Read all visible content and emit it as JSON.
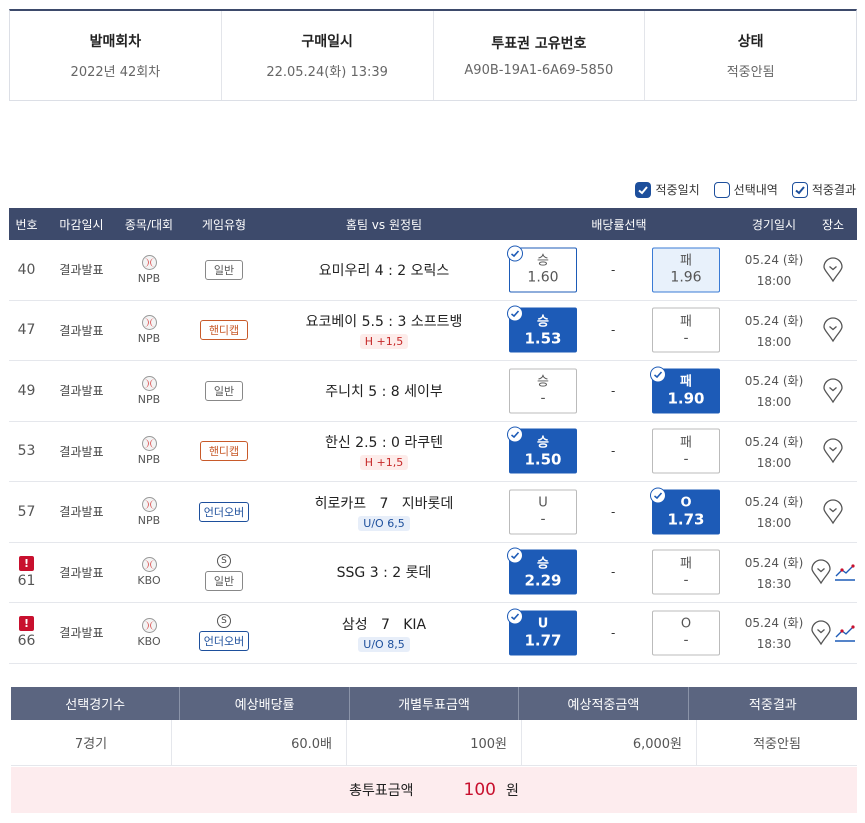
{
  "info": {
    "round_label": "발매회차",
    "round_value": "2022년 42회차",
    "date_label": "구매일시",
    "date_value": "22.05.24(화) 13:39",
    "ticket_label": "투표권 고유번호",
    "ticket_value": "A90B-19A1-6A69-5850",
    "status_label": "상태",
    "status_value": "적중안됨"
  },
  "legend": {
    "hit": "적중일치",
    "selected": "선택내역",
    "result": "적중결과"
  },
  "header": {
    "no": "번호",
    "close": "마감일시",
    "league": "종목/대회",
    "type": "게임유형",
    "match": "홈팀 vs 원정팀",
    "odds": "배당률선택",
    "date": "경기일시",
    "place": "장소"
  },
  "rows": [
    {
      "no": "40",
      "close": "결과발표",
      "league": "NPB",
      "type": "일반",
      "match": "요미우리 4 : 2 오릭스",
      "sub": "",
      "left_label": "승",
      "left_odds": "1.60",
      "mid": "-",
      "right_label": "패",
      "right_odds": "1.96",
      "date": "05.24 (화)",
      "time": "18:00"
    },
    {
      "no": "47",
      "close": "결과발표",
      "league": "NPB",
      "type": "핸디캡",
      "match": "요코베이 5.5 : 3 소프트뱅",
      "sub": "H +1,5",
      "left_label": "승",
      "left_odds": "1.53",
      "mid": "-",
      "right_label": "패",
      "right_odds": "-",
      "date": "05.24 (화)",
      "time": "18:00"
    },
    {
      "no": "49",
      "close": "결과발표",
      "league": "NPB",
      "type": "일반",
      "match": "주니치 5 : 8 세이부",
      "sub": "",
      "left_label": "승",
      "left_odds": "-",
      "mid": "-",
      "right_label": "패",
      "right_odds": "1.90",
      "date": "05.24 (화)",
      "time": "18:00"
    },
    {
      "no": "53",
      "close": "결과발표",
      "league": "NPB",
      "type": "핸디캡",
      "match": "한신 2.5 : 0 라쿠텐",
      "sub": "H +1,5",
      "left_label": "승",
      "left_odds": "1.50",
      "mid": "-",
      "right_label": "패",
      "right_odds": "-",
      "date": "05.24 (화)",
      "time": "18:00"
    },
    {
      "no": "57",
      "close": "결과발표",
      "league": "NPB",
      "type": "언더오버",
      "match": "히로카프   7   지바롯데",
      "sub": "U/O 6,5",
      "left_label": "U",
      "left_odds": "-",
      "mid": "-",
      "right_label": "O",
      "right_odds": "1.73",
      "date": "05.24 (화)",
      "time": "18:00"
    },
    {
      "no": "61",
      "close": "결과발표",
      "league": "KBO",
      "type": "일반",
      "match": "SSG 3 : 2 롯데",
      "sub": "",
      "left_label": "승",
      "left_odds": "2.29",
      "mid": "-",
      "right_label": "패",
      "right_odds": "-",
      "date": "05.24 (화)",
      "time": "18:30"
    },
    {
      "no": "66",
      "close": "결과발표",
      "league": "KBO",
      "type": "언더오버",
      "match": "삼성   7   KIA",
      "sub": "U/O 8,5",
      "left_label": "U",
      "left_odds": "1.77",
      "mid": "-",
      "right_label": "O",
      "right_odds": "-",
      "date": "05.24 (화)",
      "time": "18:30"
    }
  ],
  "summary": {
    "h1": "선택경기수",
    "h2": "예상배당률",
    "h3": "개별투표금액",
    "h4": "예상적중금액",
    "h5": "적중결과",
    "v1": "7경기",
    "v2": "60.0배",
    "v3": "100원",
    "v4": "6,000원",
    "v5": "적중안됨"
  },
  "total": {
    "label": "총투표금액",
    "amount": "100",
    "unit": "원"
  },
  "colors": {
    "header_bg": "#3d4a6b",
    "win_blue": "#1d5bb7",
    "alert_red": "#c8102e"
  }
}
